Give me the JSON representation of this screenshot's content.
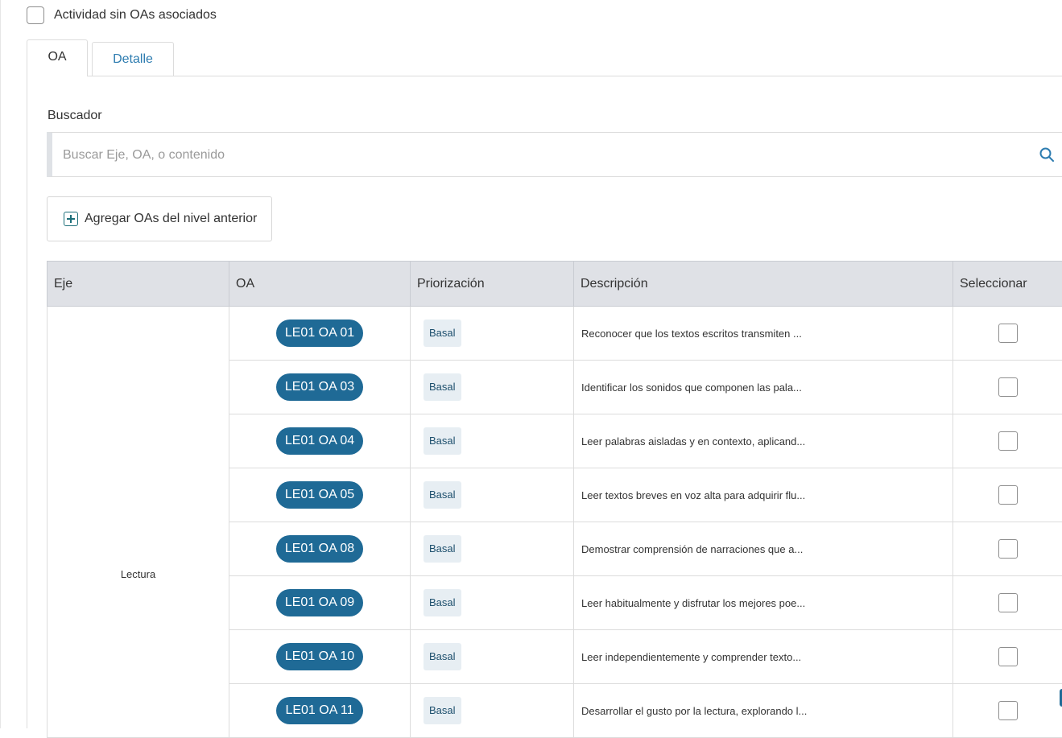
{
  "no_oa_checkbox": {
    "label": "Actividad sin OAs asociados"
  },
  "tabs": [
    {
      "label": "OA",
      "active": true
    },
    {
      "label": "Detalle",
      "active": false
    }
  ],
  "search": {
    "label": "Buscador",
    "placeholder": "Buscar Eje, OA, o contenido",
    "value": ""
  },
  "add_button": {
    "label": "Agregar OAs del nivel anterior"
  },
  "table": {
    "headers": [
      "Eje",
      "OA",
      "Priorización",
      "Descripción",
      "Seleccionar"
    ],
    "eje": "Lectura",
    "rows": [
      {
        "oa": "LE01 OA 01",
        "prioridad": "Basal",
        "descripcion": "Reconocer que los textos escritos transmiten ..."
      },
      {
        "oa": "LE01 OA 03",
        "prioridad": "Basal",
        "descripcion": "Identificar los sonidos que componen las pala..."
      },
      {
        "oa": "LE01 OA 04",
        "prioridad": "Basal",
        "descripcion": "Leer palabras aisladas y en contexto, aplicand..."
      },
      {
        "oa": "LE01 OA 05",
        "prioridad": "Basal",
        "descripcion": "Leer textos breves en voz alta para adquirir flu..."
      },
      {
        "oa": "LE01 OA 08",
        "prioridad": "Basal",
        "descripcion": "Demostrar comprensión de narraciones que a..."
      },
      {
        "oa": "LE01 OA 09",
        "prioridad": "Basal",
        "descripcion": "Leer habitualmente y disfrutar los mejores poe..."
      },
      {
        "oa": "LE01 OA 10",
        "prioridad": "Basal",
        "descripcion": "Leer independientemente y comprender texto..."
      },
      {
        "oa": "LE01 OA 11",
        "prioridad": "Basal",
        "descripcion": "Desarrollar el gusto por la lectura, explorando l..."
      }
    ]
  },
  "colors": {
    "oa_pill": "#1f6a96",
    "tab_inactive_text": "#2d7cb0",
    "header_bg": "#dfe1e6",
    "badge_bg": "#e7eef3"
  }
}
